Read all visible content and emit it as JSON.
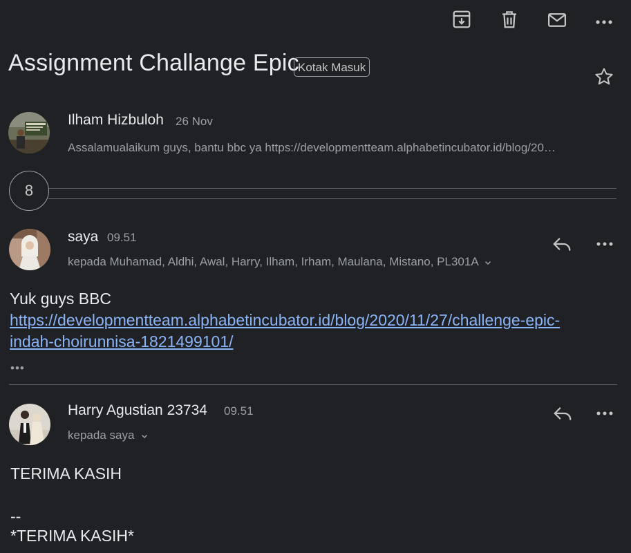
{
  "toolbar": {
    "icons": [
      "archive-icon",
      "trash-icon",
      "mail-icon",
      "more-icon"
    ]
  },
  "thread": {
    "subject": "Assignment Challange Epic",
    "label": "Kotak Masuk"
  },
  "messages": [
    {
      "sender": "Ilham Hizbuloh",
      "time": "26 Nov",
      "snippet": "Assalamualaikum guys, bantu bbc ya https://developmentteam.alphabetincubator.id/blog/20…"
    },
    {
      "sender": "saya",
      "time": "09.51",
      "recipients": "kepada Muhamad, Aldhi, Awal, Harry, Ilham, Irham, Maulana, Mistano, PL301A",
      "body_line1": "Yuk guys BBC",
      "link_line1": "https://developmentteam.alphabetincubator.id/blog/2020/11/27/challenge-epic-",
      "link_line2": "indah-choirunnisa-1821499101/",
      "ellipsis": "•••"
    },
    {
      "sender": "Harry Agustian 23734",
      "time": "09.51",
      "recipients": "kepada saya",
      "body_line1": "TERIMA KASIH",
      "sig_sep": "--",
      "sig_line": "*TERIMA KASIH*"
    }
  ],
  "collapsed_count": "8",
  "colors": {
    "background": "#202124",
    "text": "#e8eaed",
    "muted": "#9aa0a6",
    "link": "#8ab4f8"
  }
}
